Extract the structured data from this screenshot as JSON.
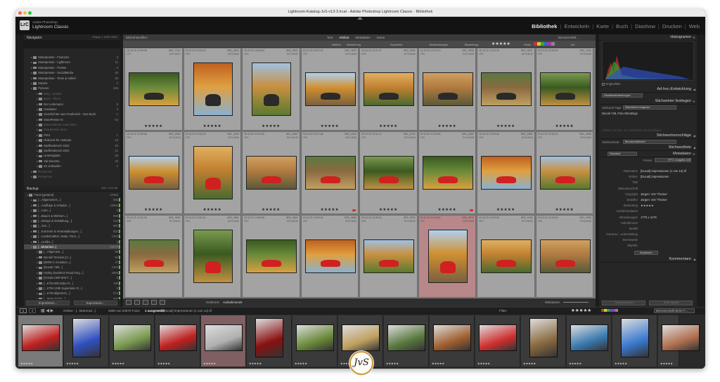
{
  "window": {
    "title": "Lightroom-Katalog-JvS-v13-3.lrcat - Adobe Photoshop Lightroom Classic - Bibliothek"
  },
  "identity": {
    "logo": "LrC",
    "line1": "Adobe Photoshop",
    "line2": "Lightroom Classic"
  },
  "modules": [
    {
      "label": "Bibliothek",
      "active": true
    },
    {
      "label": "Entwickeln",
      "active": false
    },
    {
      "label": "Karte",
      "active": false
    },
    {
      "label": "Buch",
      "active": false
    },
    {
      "label": "Diashow",
      "active": false
    },
    {
      "label": "Drucken",
      "active": false
    },
    {
      "label": "Web",
      "active": false
    }
  ],
  "left_panel": {
    "navigator": {
      "title": "Navigator",
      "zoom": "Einpas. 1 100% 300%"
    },
    "folders": [
      {
        "name": "Motorpresse - Finanzen",
        "count": "3",
        "state": "normal"
      },
      {
        "name": "Motorpresse - Lightroom",
        "count": "11",
        "state": "normal"
      },
      {
        "name": "Motorpresse - Presse",
        "count": "2",
        "state": "normal"
      },
      {
        "name": "Motorpresse - SocialMedia",
        "count": "40",
        "state": "normal"
      },
      {
        "name": "Motorpresse - Texte & Artikel",
        "count": "38",
        "state": "normal"
      },
      {
        "name": "Movies",
        "count": "2",
        "state": "normal"
      },
      {
        "name": "Pictures",
        "count": "226",
        "state": "normal"
      },
      {
        "name": "Blog - Header",
        "count": "",
        "state": "dim"
      },
      {
        "name": "Buch - Klima",
        "count": "",
        "state": "dim"
      },
      {
        "name": "Der Lebemann",
        "count": "8",
        "state": "normal"
      },
      {
        "name": "Gardasee",
        "count": "3",
        "state": "normal"
      },
      {
        "name": "Geschichten aus Frankreich - Das Buch",
        "count": "1",
        "state": "normal"
      },
      {
        "name": "MotoPresse KI",
        "count": "52",
        "state": "normal"
      },
      {
        "name": "Motorradreise Laos 2024",
        "count": "",
        "state": "dim"
      },
      {
        "name": "Pasuerreise 2014",
        "count": "",
        "state": "dim"
      },
      {
        "name": "Print",
        "count": "1",
        "state": "normal"
      },
      {
        "name": "RideLink für Hotteulo",
        "count": "15",
        "state": "normal"
      },
      {
        "name": "Südfrankreich 2023",
        "count": "25",
        "state": "normal"
      },
      {
        "name": "Südfrankreich 2024",
        "count": "21",
        "state": "normal"
      },
      {
        "name": "Untersigsäts",
        "count": "25",
        "state": "normal"
      },
      {
        "name": "Val Sinestra",
        "count": "33",
        "state": "normal"
      },
      {
        "name": "Zu verkaufen",
        "count": "1",
        "state": "normal"
      },
      {
        "name": "Resources",
        "count": "",
        "state": "dim"
      },
      {
        "name": "Resources",
        "count": "",
        "state": "dim"
      }
    ],
    "backup": {
      "label": "Backup",
      "info": "9/32 / 10/4 GB"
    },
    "collections": [
      {
        "name": "Fotos (gesamt)",
        "count": "47662",
        "state": "normal"
      },
      {
        "name": "[...Allgemeines...]",
        "count": "566",
        "state": "normal"
      },
      {
        "name": "[...Ausflüge & Urlaube...]",
        "count": "15694",
        "state": "normal"
      },
      {
        "name": "[...Auto...]",
        "count": "6",
        "state": "normal"
      },
      {
        "name": "[...Bauen & Wohnen...]",
        "count": "886",
        "state": "normal"
      },
      {
        "name": "[...Design & Gestaltung...]",
        "count": "224",
        "state": "normal"
      },
      {
        "name": "[...JvS...]",
        "count": "967",
        "state": "normal"
      },
      {
        "name": "[...Konzerte & Veranstaltungen...]",
        "count": "502",
        "state": "normal"
      },
      {
        "name": "[...Landschaften, Natur, Tiere...]",
        "count": "1304",
        "state": "normal"
      },
      {
        "name": "[...Lerdbt...]",
        "count": "3",
        "state": "normal"
      },
      {
        "name": "[...Motorrad...]",
        "count": "23570",
        "state": "selected"
      },
      {
        "name": "[...Allgemein...]",
        "count": "89",
        "state": "normal"
      },
      {
        "name": "Benelli Tornado [ct...]",
        "count": "52",
        "state": "normal"
      },
      {
        "name": "[BMW C evolution...]",
        "count": "47",
        "state": "normal"
      },
      {
        "name": "[Ducati 748i...]",
        "count": "1304",
        "state": "normal"
      },
      {
        "name": "Harley Davidson Road King...]",
        "count": "2666",
        "state": "normal"
      },
      {
        "name": "[Honda CBR 600 F...]",
        "count": "5",
        "state": "normal"
      },
      {
        "name": "[...KTM 690 Duke R...]",
        "count": "199",
        "state": "normal"
      },
      {
        "name": "[...KTM 1290 Superduke R...]",
        "count": "9",
        "state": "normal"
      },
      {
        "name": "[...KTM allgemein...]",
        "count": "572",
        "state": "normal"
      },
      {
        "name": "[...Moto Guzzi...]",
        "count": "696",
        "state": "normal"
      }
    ],
    "import_label": "Importieren...",
    "export_label": "Exportieren..."
  },
  "filter_bar": {
    "title": "Bibliotheksfilter:",
    "tabs": [
      {
        "label": "Text",
        "active": false
      },
      {
        "label": "Attribut",
        "active": true
      },
      {
        "label": "Metadaten",
        "active": false
      },
      {
        "label": "Keine",
        "active": false
      }
    ],
    "preset": "Benutzerdefi..."
  },
  "attribute_bar": {
    "label": "Attribut",
    "markierung": "Markierung",
    "exportiert": "Exportiert",
    "bearbeitungen": "Bearbeitungen",
    "bewertung": "Bewertung",
    "stars": "★★★★★",
    "farbe": "Farbe",
    "art": "Art"
  },
  "grid": {
    "rows": [
      [
        {
          "num": "15.10.22 12:09:36",
          "name": "IMG_7019",
          "ext": "CR3",
          "dim": "2047x3640",
          "stars": "★★★★★",
          "state": "normal",
          "flag": false
        },
        {
          "num": "15.10.22 13:03:25",
          "name": "IMG_2631",
          "ext": "CR3",
          "dim": "5472x3648",
          "stars": "★★★★★",
          "state": "normal",
          "flag": false
        },
        {
          "num": "15.10.22 13:03:04",
          "name": "IMG_2632",
          "ext": "CR3",
          "dim": "5472x3648",
          "stars": "★★★★★",
          "state": "normal",
          "flag": false
        },
        {
          "num": "15.10.22 13:07:02",
          "name": "IMG_2634",
          "ext": "CR3",
          "dim": "5472x3648",
          "stars": "★★★★★",
          "state": "normal",
          "flag": false
        },
        {
          "num": "15.10.22 13:11:27",
          "name": "IMG_2635",
          "ext": "CR3",
          "dim": "5472x3648",
          "stars": "★★★★★",
          "state": "normal",
          "flag": false
        },
        {
          "num": "15.10.22 13:12:13",
          "name": "IMG_2636",
          "ext": "CR3",
          "dim": "5472x3648",
          "stars": "★★★★★",
          "state": "normal",
          "flag": false
        },
        {
          "num": "15.10.22 13:12:32",
          "name": "IMG_2637",
          "ext": "CR3",
          "dim": "5472x3648",
          "stars": "★★★★★",
          "state": "normal",
          "flag": false
        },
        {
          "num": "15.10.22 13:45:29",
          "name": "IMG_1151",
          "ext": "CR3",
          "dim": "5472x3648",
          "stars": "★★★★★",
          "state": "normal",
          "flag": false
        }
      ],
      [
        {
          "num": "15.10.22 12:50:53",
          "name": "IMG_2646",
          "ext": "CR3",
          "dim": "5472x3648",
          "stars": "★★★★★",
          "state": "normal",
          "flag": false
        },
        {
          "num": "29.10.22 12:04:16",
          "name": "IMG_2649",
          "ext": "CR3",
          "dim": "5472x3648",
          "stars": "★★★★★",
          "state": "normal",
          "flag": false
        },
        {
          "num": "29.10.22 12:04:40",
          "name": "IMG_2650",
          "ext": "CR3",
          "dim": "5472x3648",
          "stars": "★★★★★",
          "state": "normal",
          "flag": false
        },
        {
          "num": "29.10.22 12:07:08",
          "name": "IMG_3202",
          "ext": "CR3",
          "dim": "5472x3648",
          "stars": "★★★★★",
          "state": "normal",
          "flag": true
        },
        {
          "num": "29.10.22 12:11:12",
          "name": "IMG_1215",
          "ext": "CR3",
          "dim": "5472x3648",
          "stars": "★★★★★",
          "state": "normal",
          "flag": false
        },
        {
          "num": "29.10.22 12:49:05",
          "name": "IMG_2654",
          "ext": "CR3",
          "dim": "5472x3648",
          "stars": "★★★★★",
          "state": "normal",
          "flag": true
        },
        {
          "num": "29.10.22 12:50:04",
          "name": "IMG_2656",
          "ext": "CR3",
          "dim": "5472x3648",
          "stars": "★★★★★",
          "state": "normal",
          "flag": false
        },
        {
          "num": "29.10.22 12:50:24",
          "name": "IMG_2658",
          "ext": "CR3",
          "dim": "5472x3648",
          "stars": "★★★★★",
          "state": "normal",
          "flag": false
        }
      ],
      [
        {
          "num": "29.10.22 12:51:04",
          "name": "IMG_2660",
          "ext": "CR3",
          "dim": "5472x3648",
          "stars": "",
          "state": "normal",
          "flag": false
        },
        {
          "num": "29.10.22 12:51:10",
          "name": "IMG_2661",
          "ext": "CR3",
          "dim": "5472x3648",
          "stars": "",
          "state": "normal",
          "flag": false
        },
        {
          "num": "29.10.22 12:54:55",
          "name": "IMG_2663",
          "ext": "CR3",
          "dim": "5472x3648",
          "stars": "",
          "state": "normal",
          "flag": false
        },
        {
          "num": "29.10.22 13:08:14",
          "name": "IMG_2665",
          "ext": "CR3",
          "dim": "5472x3648",
          "stars": "",
          "state": "normal",
          "flag": false
        },
        {
          "num": "29.10.22 13:40:31",
          "name": "IMG_2670",
          "ext": "CR3",
          "dim": "5472x3648",
          "stars": "",
          "state": "normal",
          "flag": false
        },
        {
          "num": "29.10.22 14:19:02",
          "name": "IMG_2672",
          "ext": "CR3",
          "dim": "5472x3648",
          "stars": "",
          "state": "red",
          "flag": false
        },
        {
          "num": "29.10.22 14:20:54",
          "name": "IMG_1048",
          "ext": "CR3",
          "dim": "5472x3648",
          "stars": "",
          "state": "normal",
          "flag": false
        },
        {
          "num": "29.10.22 14:20:04",
          "name": "IMG_1050",
          "ext": "CR3",
          "dim": "5472x3648",
          "stars": "",
          "state": "normal",
          "flag": false
        }
      ]
    ]
  },
  "toolbar": {
    "sort_label": "Sortieren:",
    "sort_value": "Aufnahmezeit",
    "thumb_label": "Miniaturen"
  },
  "right_panel": {
    "histogram": "Histogramm",
    "original": "Originalfoto",
    "quick_develop": "Ad-hoc-Entwicklung",
    "quick_preset": "Standardeinstellungen",
    "keywording": "Stichwörter festlegen",
    "keyword_tags_label": "Stichwort-Tags",
    "keyword_tags_value": "Stichwörter eingeben",
    "keywords": "Ducati 748, Foto-Shootings",
    "click_here": "Klicken Sie hier, um Stichwörter hinzuzufügen",
    "suggestions": "Stichwortvorschläge",
    "keyword_set_label": "Stichwortsatz",
    "keyword_set_value": "Benutzerdefiniert",
    "keyword_list": "Stichwortliste",
    "metadata": "Metadaten",
    "metadata_preset_value": "Standard",
    "preset_label": "Preset",
    "preset_value": "IPTC-Vorgabe-JvS",
    "metadata_rows": [
      {
        "key": "Dateiname",
        "value": "[Ducati] Impressionen (1 von 12).tif"
      },
      {
        "key": "Ordner",
        "value": "[Ducati] Impressionen"
      },
      {
        "key": "Titel",
        "value": ""
      },
      {
        "key": "Bildunterschrift",
        "value": ""
      },
      {
        "key": "Copyright",
        "value": "Jürgen 'JvS' Theiner"
      },
      {
        "key": "Ersteller",
        "value": "Jürgen 'JvS' Theiner"
      },
      {
        "key": "Bewertung",
        "value": "★★★★★"
      },
      {
        "key": "Aufnahmedatum",
        "value": ""
      },
      {
        "key": "Abmessungen",
        "value": "1775 x 1179"
      },
      {
        "key": "Aufnahmeort",
        "value": ""
      },
      {
        "key": "Modell",
        "value": ""
      },
      {
        "key": "Kamera-/...unterstellung",
        "value": ""
      },
      {
        "key": "Brennweite",
        "value": ""
      },
      {
        "key": "Objektiv",
        "value": ""
      }
    ],
    "anpassen": "Anpassen...",
    "comments": "Kommentare",
    "sync_label": "Synchronisieren",
    "sync_settings": "Einst. synchr."
  },
  "filmstrip_bar": {
    "page1": "1",
    "page2": "2",
    "path": "Ordner : [...Motorrad...]",
    "summary": "2080 von 23570 Fotos",
    "selected": "1 ausgewählt",
    "file": "/[Ducati] Impressionen (1 von 12).tif",
    "filter_label": "Filter:",
    "stars": "★★★★★",
    "preset": "Benutzerdefinierter F..."
  },
  "filmstrip": [
    {
      "state": "sel",
      "stars": "★★★★★"
    },
    {
      "state": "normal",
      "stars": "★★★★★"
    },
    {
      "state": "normal",
      "stars": "★★★★★"
    },
    {
      "state": "normal",
      "stars": "★★★★★"
    },
    {
      "state": "red",
      "stars": "★★★★★"
    },
    {
      "state": "normal",
      "stars": "★★★★★"
    },
    {
      "state": "normal",
      "stars": "★★★★★"
    },
    {
      "state": "normal",
      "stars": "★★★★★"
    },
    {
      "state": "normal",
      "stars": "★★★★★"
    },
    {
      "state": "normal",
      "stars": "★★★★★"
    },
    {
      "state": "normal",
      "stars": "★★★★★"
    },
    {
      "state": "normal",
      "stars": "★★★★★"
    },
    {
      "state": "normal",
      "stars": "★★★★★"
    },
    {
      "state": "normal",
      "stars": "★★★★★"
    },
    {
      "state": "normal",
      "stars": "★★★★★"
    }
  ],
  "watermark": "JvS",
  "colors": {
    "background": "#1c1c1c",
    "panel": "#262626",
    "grid": "#7a7a7a",
    "selected_cell": "#cfcfcf",
    "red_label": "#b8878a",
    "flag": "#d03030"
  }
}
